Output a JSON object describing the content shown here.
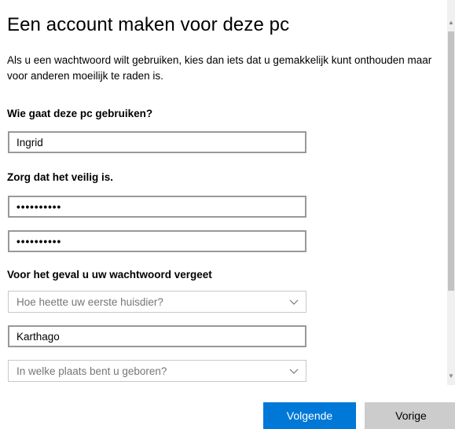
{
  "page": {
    "title": "Een account maken voor deze pc",
    "intro": "Als u een wachtwoord wilt gebruiken, kies dan iets dat u gemakkelijk kunt onthouden maar voor anderen moeilijk te raden is."
  },
  "user_section": {
    "label": "Wie gaat deze pc gebruiken?",
    "username_value": "Ingrid"
  },
  "password_section": {
    "label": "Zorg dat het veilig is.",
    "password_value": "••••••••••",
    "confirm_value": "••••••••••"
  },
  "recovery_section": {
    "label": "Voor het geval u uw wachtwoord vergeet",
    "question1_placeholder": "Hoe heette uw eerste huisdier?",
    "answer1_value": "Karthago",
    "question2_placeholder": "In welke plaats bent u geboren?"
  },
  "buttons": {
    "next_label": "Volgende",
    "back_label": "Vorige"
  },
  "colors": {
    "accent": "#0078d7",
    "secondary_button": "#cccccc",
    "field_border": "#999999"
  },
  "icons": {
    "dropdown": "chevron-down-icon",
    "scroll_up": "scroll-up-arrow-icon",
    "scroll_down": "scroll-down-arrow-icon"
  }
}
